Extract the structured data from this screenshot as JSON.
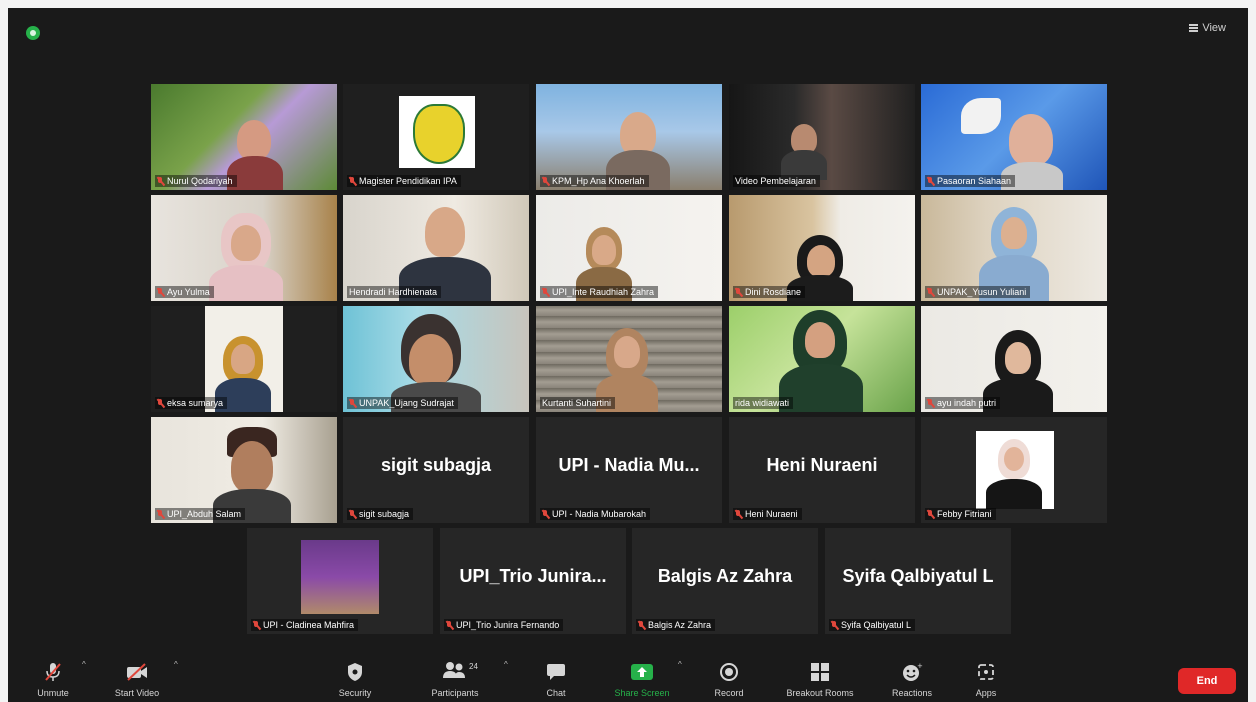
{
  "top_bar": {
    "view_label": "View"
  },
  "tiles": [
    {
      "display": "Nurul Qodariyah",
      "video": true
    },
    {
      "display": "Magister Pendidikan IPA",
      "video": true
    },
    {
      "display": "KPM_Hp Ana Khoerlah",
      "video": true
    },
    {
      "display": "Video Pembelajaran",
      "video": true
    },
    {
      "display": "Pasaoran Siahaan",
      "video": true
    },
    {
      "display": "Ayu Yulma",
      "video": true
    },
    {
      "display": "Hendradi Hardhienata",
      "video": true
    },
    {
      "display": "UPI_Inte Raudhiah Zahra",
      "video": true
    },
    {
      "display": "Dini Rosdiane",
      "video": true
    },
    {
      "display": "UNPAK_Yusun Yuliani",
      "video": true
    },
    {
      "display": "eksa sumarya",
      "video": true
    },
    {
      "display": "UNPAK_Ujang Sudrajat",
      "video": true
    },
    {
      "display": "Kurtanti Suhartini",
      "video": true
    },
    {
      "display": "rida widiawati",
      "video": true
    },
    {
      "display": "ayu indah putri",
      "video": true
    },
    {
      "display": "UPI_Abduh Salam",
      "video": true
    },
    {
      "display": "sigit subagja",
      "big": "sigit subagja",
      "video": false
    },
    {
      "display": "UPI - Nadia Mubarokah",
      "big": "UPI - Nadia Mu...",
      "video": false
    },
    {
      "display": "Heni Nuraeni",
      "big": "Heni Nuraeni",
      "video": false
    },
    {
      "display": "Febby Fitriani",
      "video": false
    },
    {
      "display": "UPI - Cladinea Mahfira",
      "video": false
    },
    {
      "display": "UPI_Trio Junira Fernando",
      "big": "UPI_Trio  Junira...",
      "video": false
    },
    {
      "display": "Balgis Az Zahra",
      "big": "Balgis Az Zahra",
      "video": false
    },
    {
      "display": "Syifa Qalbiyatul L",
      "big": "Syifa Qalbiyatul L",
      "video": false
    }
  ],
  "toolbar": {
    "unmute": "Unmute",
    "start_video": "Start Video",
    "security": "Security",
    "participants": "Participants",
    "participants_count": "24",
    "chat": "Chat",
    "share_screen": "Share Screen",
    "record": "Record",
    "breakout_rooms": "Breakout Rooms",
    "reactions": "Reactions",
    "apps": "Apps",
    "end": "End"
  },
  "colors": {
    "background": "#1a1a1a",
    "tile": "#262626",
    "share_green": "#26b14a",
    "end_red": "#e02828",
    "active_speaker": "#b7e35b",
    "muted_red": "#e0473c"
  }
}
